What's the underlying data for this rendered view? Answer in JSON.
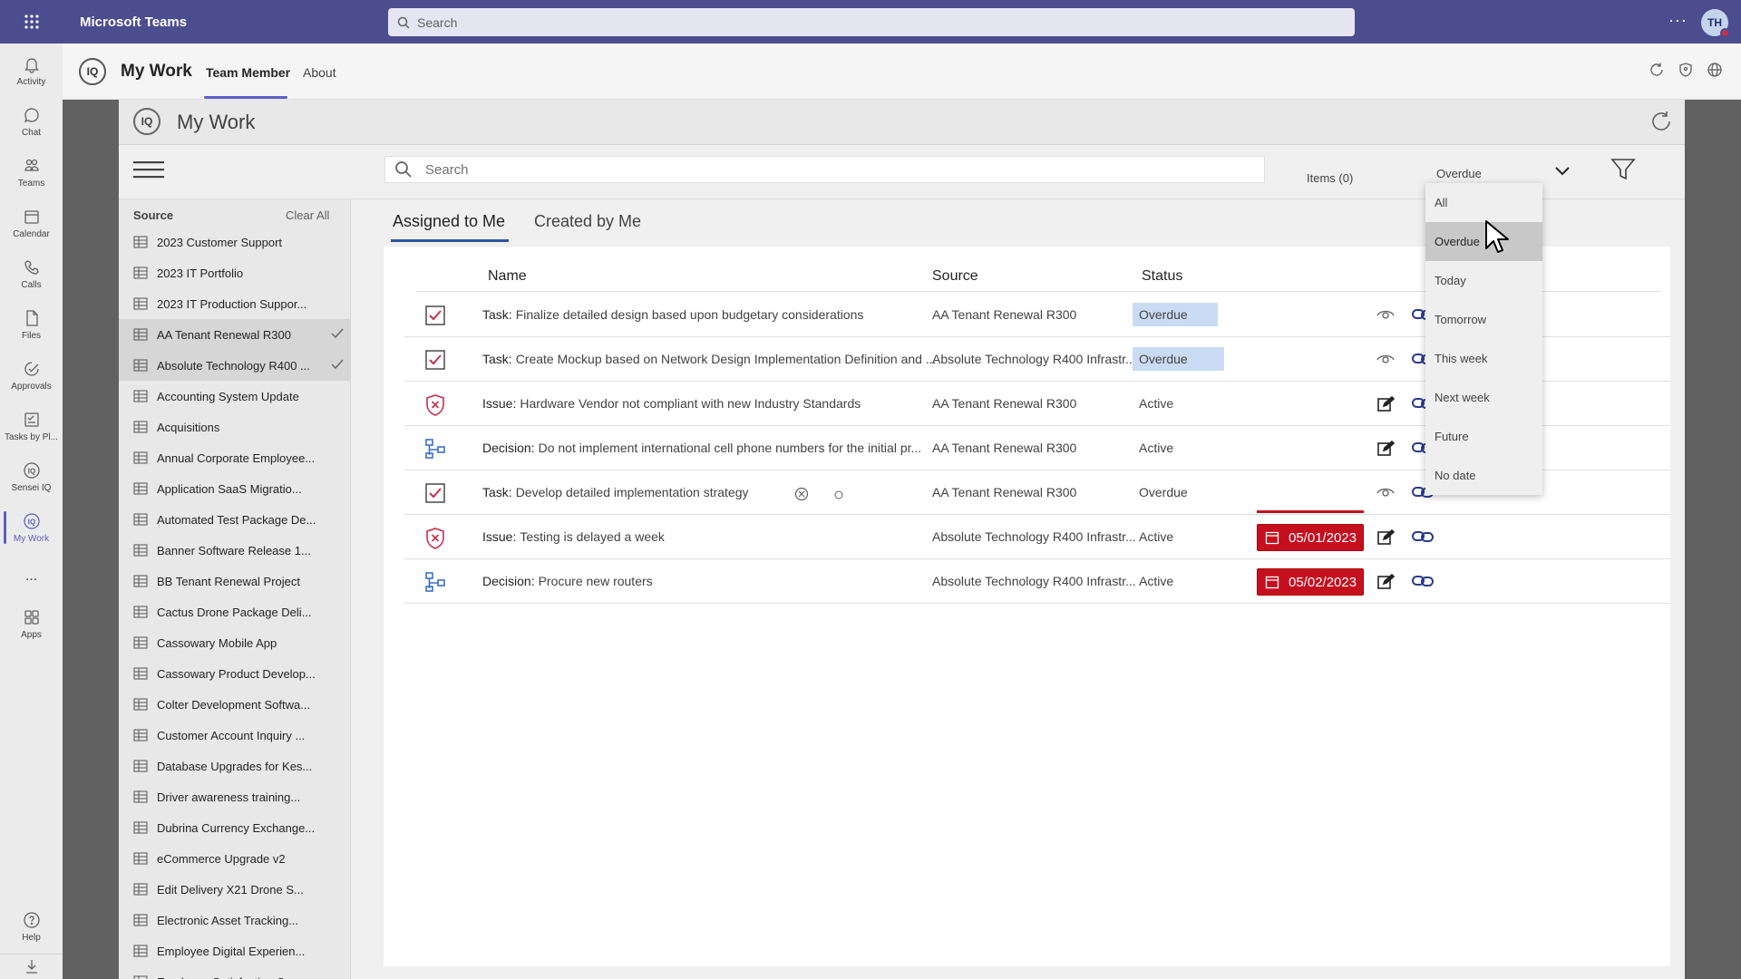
{
  "titlebar": {
    "app_name": "Microsoft Teams",
    "search_placeholder": "Search",
    "more": "···",
    "avatar_initials": "TH"
  },
  "rail": {
    "items": [
      {
        "label": "Activity",
        "icon": "bell-icon"
      },
      {
        "label": "Chat",
        "icon": "chat-icon"
      },
      {
        "label": "Teams",
        "icon": "teams-icon"
      },
      {
        "label": "Calendar",
        "icon": "calendar-icon"
      },
      {
        "label": "Calls",
        "icon": "phone-icon"
      },
      {
        "label": "Files",
        "icon": "file-icon"
      },
      {
        "label": "Approvals",
        "icon": "approvals-icon"
      },
      {
        "label": "Tasks by Pl...",
        "icon": "tasks-icon"
      },
      {
        "label": "Sensei IQ",
        "icon": "iq-icon"
      },
      {
        "label": "My Work",
        "icon": "iq-icon"
      },
      {
        "label": "...",
        "icon": "more-icon"
      },
      {
        "label": "Apps",
        "icon": "apps-icon"
      }
    ],
    "help_label": "Help"
  },
  "app_header": {
    "logo": "IQ",
    "title": "My Work",
    "tabs": [
      "Team Member",
      "About"
    ]
  },
  "frame": {
    "logo": "IQ",
    "title": "My Work",
    "search_placeholder": "Search",
    "items_count": "Items (0)",
    "filter_value": "Overdue"
  },
  "sources": {
    "header": "Source",
    "clear_all": "Clear All",
    "items": [
      {
        "label": "2023 Customer Support",
        "selected": false
      },
      {
        "label": "2023 IT Portfolio",
        "selected": false
      },
      {
        "label": "2023 IT Production Suppor...",
        "selected": false
      },
      {
        "label": "AA Tenant Renewal R300",
        "selected": true
      },
      {
        "label": "Absolute Technology R400 ...",
        "selected": true
      },
      {
        "label": "Accounting System Update",
        "selected": false
      },
      {
        "label": "Acquisitions",
        "selected": false
      },
      {
        "label": "Annual Corporate Employee...",
        "selected": false
      },
      {
        "label": "Application SaaS Migratio...",
        "selected": false
      },
      {
        "label": "Automated Test Package De...",
        "selected": false
      },
      {
        "label": "Banner Software Release 1...",
        "selected": false
      },
      {
        "label": "BB Tenant Renewal Project",
        "selected": false
      },
      {
        "label": "Cactus Drone Package Deli...",
        "selected": false
      },
      {
        "label": "Cassowary Mobile App",
        "selected": false
      },
      {
        "label": "Cassowary Product Develop...",
        "selected": false
      },
      {
        "label": "Colter Development Softwa...",
        "selected": false
      },
      {
        "label": "Customer Account Inquiry ...",
        "selected": false
      },
      {
        "label": "Database Upgrades for Kes...",
        "selected": false
      },
      {
        "label": "Driver awareness training...",
        "selected": false
      },
      {
        "label": "Dubrina Currency Exchange...",
        "selected": false
      },
      {
        "label": "eCommerce Upgrade v2",
        "selected": false
      },
      {
        "label": "Edit Delivery X21 Drone S...",
        "selected": false
      },
      {
        "label": "Electronic Asset Tracking...",
        "selected": false
      },
      {
        "label": "Employee Digital Experien...",
        "selected": false
      },
      {
        "label": "Employee Satisfaction Sur...",
        "selected": false
      }
    ]
  },
  "main": {
    "tabs": [
      "Assigned to Me",
      "Created by Me"
    ],
    "columns": {
      "name": "Name",
      "source": "Source",
      "status": "Status"
    },
    "rows": [
      {
        "kind": "Task:",
        "name": "Finalize detailed design based upon budgetary considerations",
        "source": "AA Tenant Renewal R300",
        "status": "Overdue",
        "icon": "task-check-icon",
        "date": "",
        "action1": "view-icon"
      },
      {
        "kind": "Task:",
        "name": "Create Mockup based on Network Design Implementation Definition and ...",
        "source": "Absolute Technology R400 Infrastr...",
        "status": "Overdue",
        "icon": "task-check-icon",
        "date": "",
        "action1": "view-icon"
      },
      {
        "kind": "Issue:",
        "name": "Hardware Vendor not compliant with new Industry Standards",
        "source": "AA Tenant Renewal R300",
        "status": "Active",
        "icon": "issue-shield-icon",
        "date": "",
        "action1": "edit-icon"
      },
      {
        "kind": "Decision:",
        "name": "Do not implement international cell phone numbers for the initial pr...",
        "source": "AA Tenant Renewal R300",
        "status": "Active",
        "icon": "decision-icon",
        "date": "",
        "action1": "edit-icon"
      },
      {
        "kind": "Task:",
        "name": "Develop detailed implementation strategy",
        "source": "AA Tenant Renewal R300",
        "status": "Overdue",
        "icon": "task-check-icon",
        "date": "",
        "action1": "view-icon"
      },
      {
        "kind": "Issue:",
        "name": "Testing is delayed a week",
        "source": "Absolute Technology R400 Infrastr...",
        "status": "Active",
        "icon": "issue-shield-icon",
        "date": "05/01/2023",
        "action1": "edit-icon"
      },
      {
        "kind": "Decision:",
        "name": "Procure new routers",
        "source": "Absolute Technology R400 Infrastr...",
        "status": "Active",
        "icon": "decision-icon",
        "date": "05/02/2023",
        "action1": "edit-icon"
      }
    ]
  },
  "dropdown": {
    "options": [
      "All",
      "Overdue",
      "Today",
      "Tomorrow",
      "This week",
      "Next week",
      "Future",
      "No date"
    ],
    "selected": "Overdue"
  },
  "colors": {
    "titlebar": "#4b4d8f",
    "accent": "#5b5fc7",
    "overdue_highlight": "#c9dcf3",
    "date_badge": "#c50f1f",
    "icon_blue": "#3a6fc4",
    "issue_red": "#c4314b"
  }
}
